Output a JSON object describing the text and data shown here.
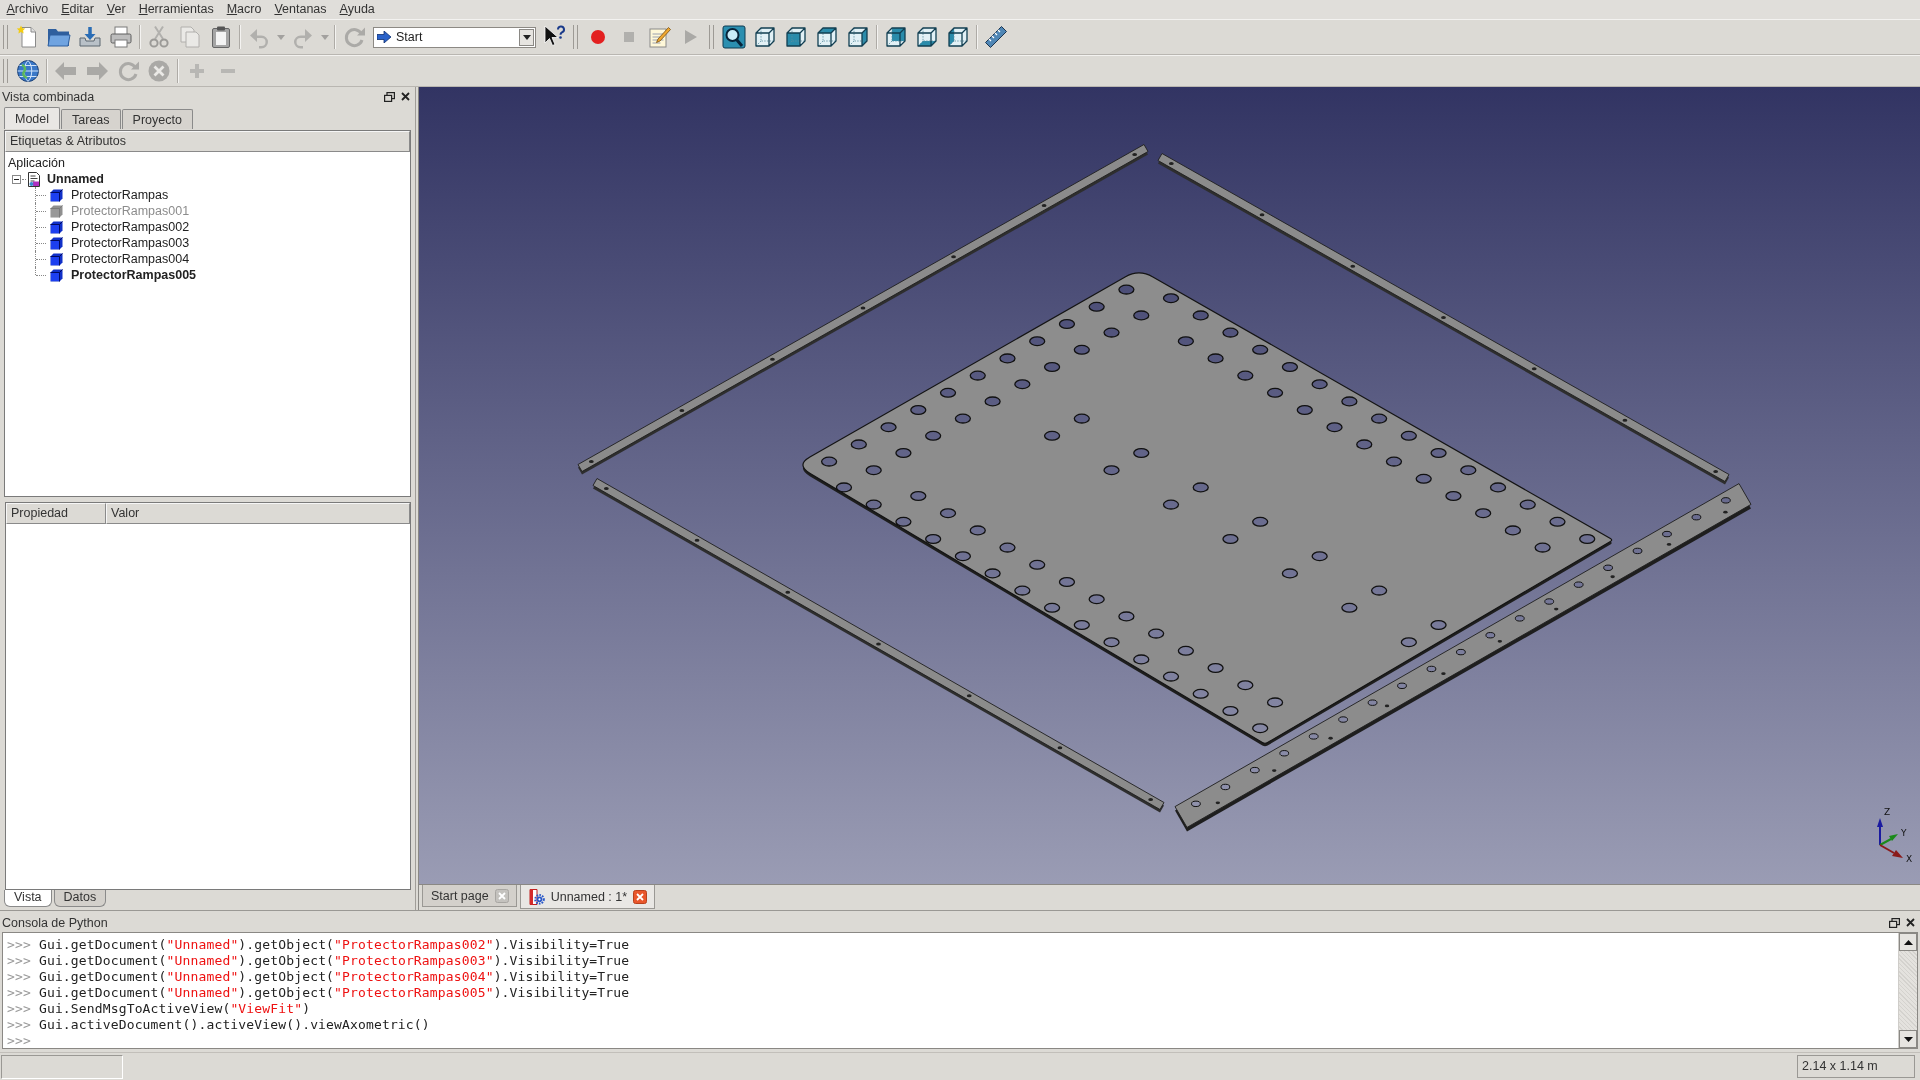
{
  "menu_bar": [
    {
      "label": "Archivo"
    },
    {
      "label": "Editar"
    },
    {
      "label": "Ver"
    },
    {
      "label": "Herramientas"
    },
    {
      "label": "Macro"
    },
    {
      "label": "Ventanas"
    },
    {
      "label": "Ayuda"
    }
  ],
  "toolbar_rows": [
    {
      "toolbars": [
        {
          "groups": [
            [
              {
                "kind": "new",
                "disabled": false
              },
              {
                "kind": "open",
                "disabled": false
              },
              {
                "kind": "save",
                "disabled": false
              },
              {
                "kind": "print",
                "disabled": false
              }
            ],
            [
              {
                "kind": "cut",
                "disabled": true
              },
              {
                "kind": "copy",
                "disabled": true
              },
              {
                "kind": "paste",
                "disabled": false
              }
            ],
            [
              {
                "kind": "undo",
                "disabled": true
              },
              {
                "kind": "menu",
                "disabled": true
              },
              {
                "kind": "redo",
                "disabled": true
              },
              {
                "kind": "menu",
                "disabled": true
              }
            ],
            [
              {
                "kind": "recompute",
                "disabled": true
              },
              {
                "kind": "combo",
                "value": "Start",
                "disabled": false
              },
              {
                "kind": "whatsthis",
                "disabled": false
              }
            ]
          ]
        },
        {
          "groups": [
            [
              {
                "kind": "record",
                "disabled": false
              },
              {
                "kind": "stop",
                "disabled": true
              },
              {
                "kind": "edit",
                "disabled": false
              },
              {
                "kind": "play",
                "disabled": true
              }
            ]
          ]
        },
        {
          "groups": [
            [
              {
                "kind": "fit",
                "disabled": false
              },
              {
                "kind": "iso",
                "disabled": false
              },
              {
                "kind": "front",
                "disabled": false
              },
              {
                "kind": "top",
                "disabled": false
              },
              {
                "kind": "right",
                "disabled": false
              }
            ],
            [
              {
                "kind": "rear",
                "disabled": false
              },
              {
                "kind": "bottom",
                "disabled": false
              },
              {
                "kind": "left",
                "disabled": false
              }
            ],
            [
              {
                "kind": "measure",
                "disabled": false
              }
            ]
          ]
        }
      ]
    },
    {
      "toolbars": [
        {
          "groups": [
            [
              {
                "kind": "globe",
                "disabled": false
              }
            ],
            [
              {
                "kind": "back",
                "disabled": true
              },
              {
                "kind": "forward",
                "disabled": true
              },
              {
                "kind": "reload",
                "disabled": true
              },
              {
                "kind": "cancel",
                "disabled": true
              }
            ],
            [
              {
                "kind": "zoomin",
                "disabled": true
              },
              {
                "kind": "zoomout",
                "disabled": true
              }
            ]
          ]
        }
      ]
    }
  ],
  "combo_view": {
    "title": "Vista combinada",
    "tabs": [
      {
        "label": "Model",
        "selected": true
      },
      {
        "label": "Tareas",
        "selected": false
      },
      {
        "label": "Proyecto",
        "selected": false
      }
    ],
    "tree": {
      "header": "Etiquetas & Atributos",
      "root": "Aplicación",
      "documents": [
        {
          "label": "Unnamed",
          "emphasized": true,
          "expanded": true,
          "children": [
            {
              "label": "ProtectorRampas",
              "hidden": false,
              "emphasized": false
            },
            {
              "label": "ProtectorRampas001",
              "hidden": true,
              "emphasized": false
            },
            {
              "label": "ProtectorRampas002",
              "hidden": false,
              "emphasized": false
            },
            {
              "label": "ProtectorRampas003",
              "hidden": false,
              "emphasized": false
            },
            {
              "label": "ProtectorRampas004",
              "hidden": false,
              "emphasized": false
            },
            {
              "label": "ProtectorRampas005",
              "hidden": false,
              "emphasized": true
            }
          ]
        }
      ]
    },
    "properties": {
      "columns": [
        "Propiedad",
        "Valor"
      ]
    },
    "bottom_tabs": [
      {
        "label": "Vista",
        "selected": true
      },
      {
        "label": "Datos",
        "selected": false
      }
    ]
  },
  "view": {
    "axis_labels": {
      "z": "Z",
      "y": "Y",
      "x": "X"
    },
    "tabs": [
      {
        "kind": "page",
        "label": "Start page",
        "selected": false
      },
      {
        "kind": "document",
        "label": "Unnamed : 1*",
        "selected": true
      }
    ]
  },
  "python_console": {
    "title": "Consola de Python",
    "lines": [
      {
        "prompt": ">>>",
        "tokens": [
          {
            "kind": "code",
            "text": "Gui.getDocument("
          },
          {
            "kind": "string",
            "text": "\"Unnamed\""
          },
          {
            "kind": "code",
            "text": ").getObject("
          },
          {
            "kind": "string",
            "text": "\"ProtectorRampas002\""
          },
          {
            "kind": "code",
            "text": ").Visibility=True"
          }
        ]
      },
      {
        "prompt": ">>>",
        "tokens": [
          {
            "kind": "code",
            "text": "Gui.getDocument("
          },
          {
            "kind": "string",
            "text": "\"Unnamed\""
          },
          {
            "kind": "code",
            "text": ").getObject("
          },
          {
            "kind": "string",
            "text": "\"ProtectorRampas003\""
          },
          {
            "kind": "code",
            "text": ").Visibility=True"
          }
        ]
      },
      {
        "prompt": ">>>",
        "tokens": [
          {
            "kind": "code",
            "text": "Gui.getDocument("
          },
          {
            "kind": "string",
            "text": "\"Unnamed\""
          },
          {
            "kind": "code",
            "text": ").getObject("
          },
          {
            "kind": "string",
            "text": "\"ProtectorRampas004\""
          },
          {
            "kind": "code",
            "text": ").Visibility=True"
          }
        ]
      },
      {
        "prompt": ">>>",
        "tokens": [
          {
            "kind": "code",
            "text": "Gui.getDocument("
          },
          {
            "kind": "string",
            "text": "\"Unnamed\""
          },
          {
            "kind": "code",
            "text": ").getObject("
          },
          {
            "kind": "string",
            "text": "\"ProtectorRampas005\""
          },
          {
            "kind": "code",
            "text": ").Visibility=True"
          }
        ]
      },
      {
        "prompt": ">>>",
        "tokens": [
          {
            "kind": "code",
            "text": "Gui.SendMsgToActiveView("
          },
          {
            "kind": "string",
            "text": "\"ViewFit\""
          },
          {
            "kind": "code",
            "text": ")"
          }
        ]
      },
      {
        "prompt": ">>>",
        "tokens": [
          {
            "kind": "code",
            "text": "Gui.activeDocument().activeView().viewAxometric()"
          }
        ]
      },
      {
        "prompt": ">>>"
      }
    ]
  },
  "status_bar": {
    "readout": "2.14 x 1.14 m"
  }
}
